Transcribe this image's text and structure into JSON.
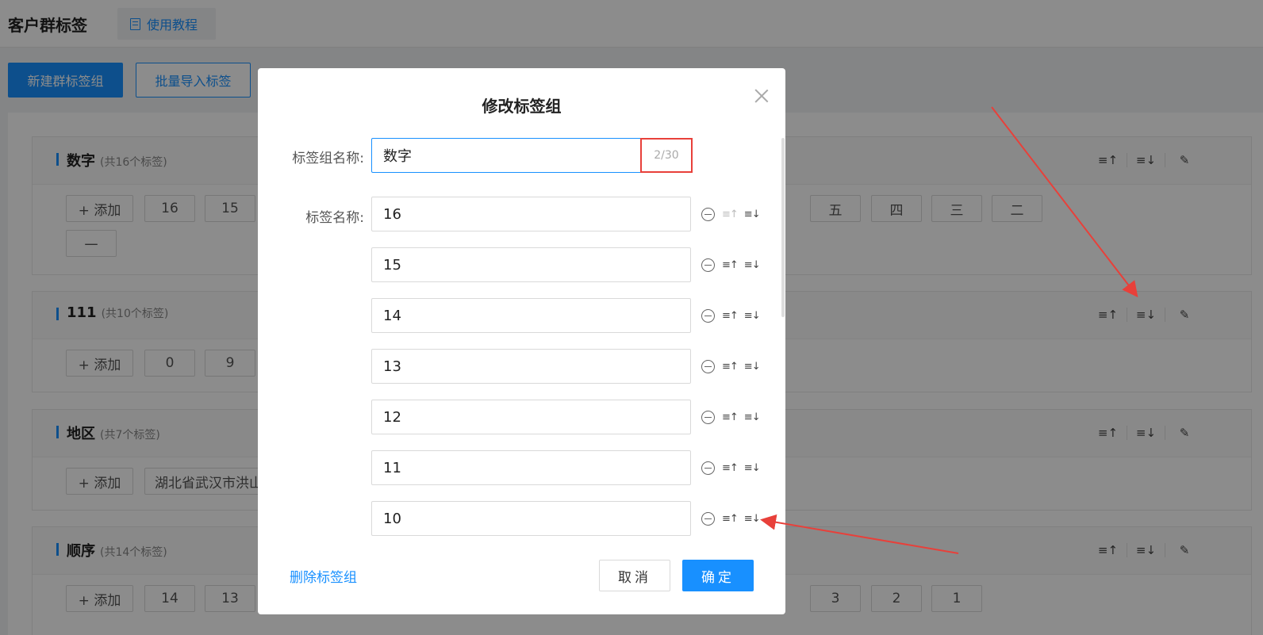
{
  "page": {
    "title": "客户群标签",
    "tutorial_label": "使用教程",
    "new_group_button": "新建群标签组",
    "import_button": "批量导入标签"
  },
  "groups": [
    {
      "name": "数字",
      "count": "(共16个标签)",
      "add_label": "+ 添加",
      "tags": [
        "16",
        "15",
        "五",
        "四",
        "三",
        "二",
        "一"
      ]
    },
    {
      "name": "111",
      "count": "(共10个标签)",
      "add_label": "+ 添加",
      "tags": [
        "0",
        "9"
      ]
    },
    {
      "name": "地区",
      "count": "(共7个标签)",
      "add_label": "+ 添加",
      "tags": [
        "湖北省武汉市洪山"
      ]
    },
    {
      "name": "顺序",
      "count": "(共14个标签)",
      "add_label": "+ 添加",
      "tags": [
        "14",
        "13",
        "3",
        "2",
        "1"
      ]
    }
  ],
  "group_icons": {
    "sort_up": "≡↑",
    "sort_down": "≡↓",
    "edit": "✎"
  },
  "modal": {
    "title": "修改标签组",
    "group_name_label": "标签组名称:",
    "group_name_value": "数字",
    "group_name_counter": "2/30",
    "tag_name_label": "标签名称:",
    "tag_rows": [
      "16",
      "15",
      "14",
      "13",
      "12",
      "11",
      "10"
    ],
    "delete_link": "删除标签组",
    "cancel_button": "取消",
    "confirm_button": "确定",
    "icons": [
      "close-icon",
      "remove-circle-icon",
      "move-up-icon",
      "move-down-icon"
    ]
  },
  "colors": {
    "primary": "#1890ff",
    "annotation": "#e8403a"
  }
}
